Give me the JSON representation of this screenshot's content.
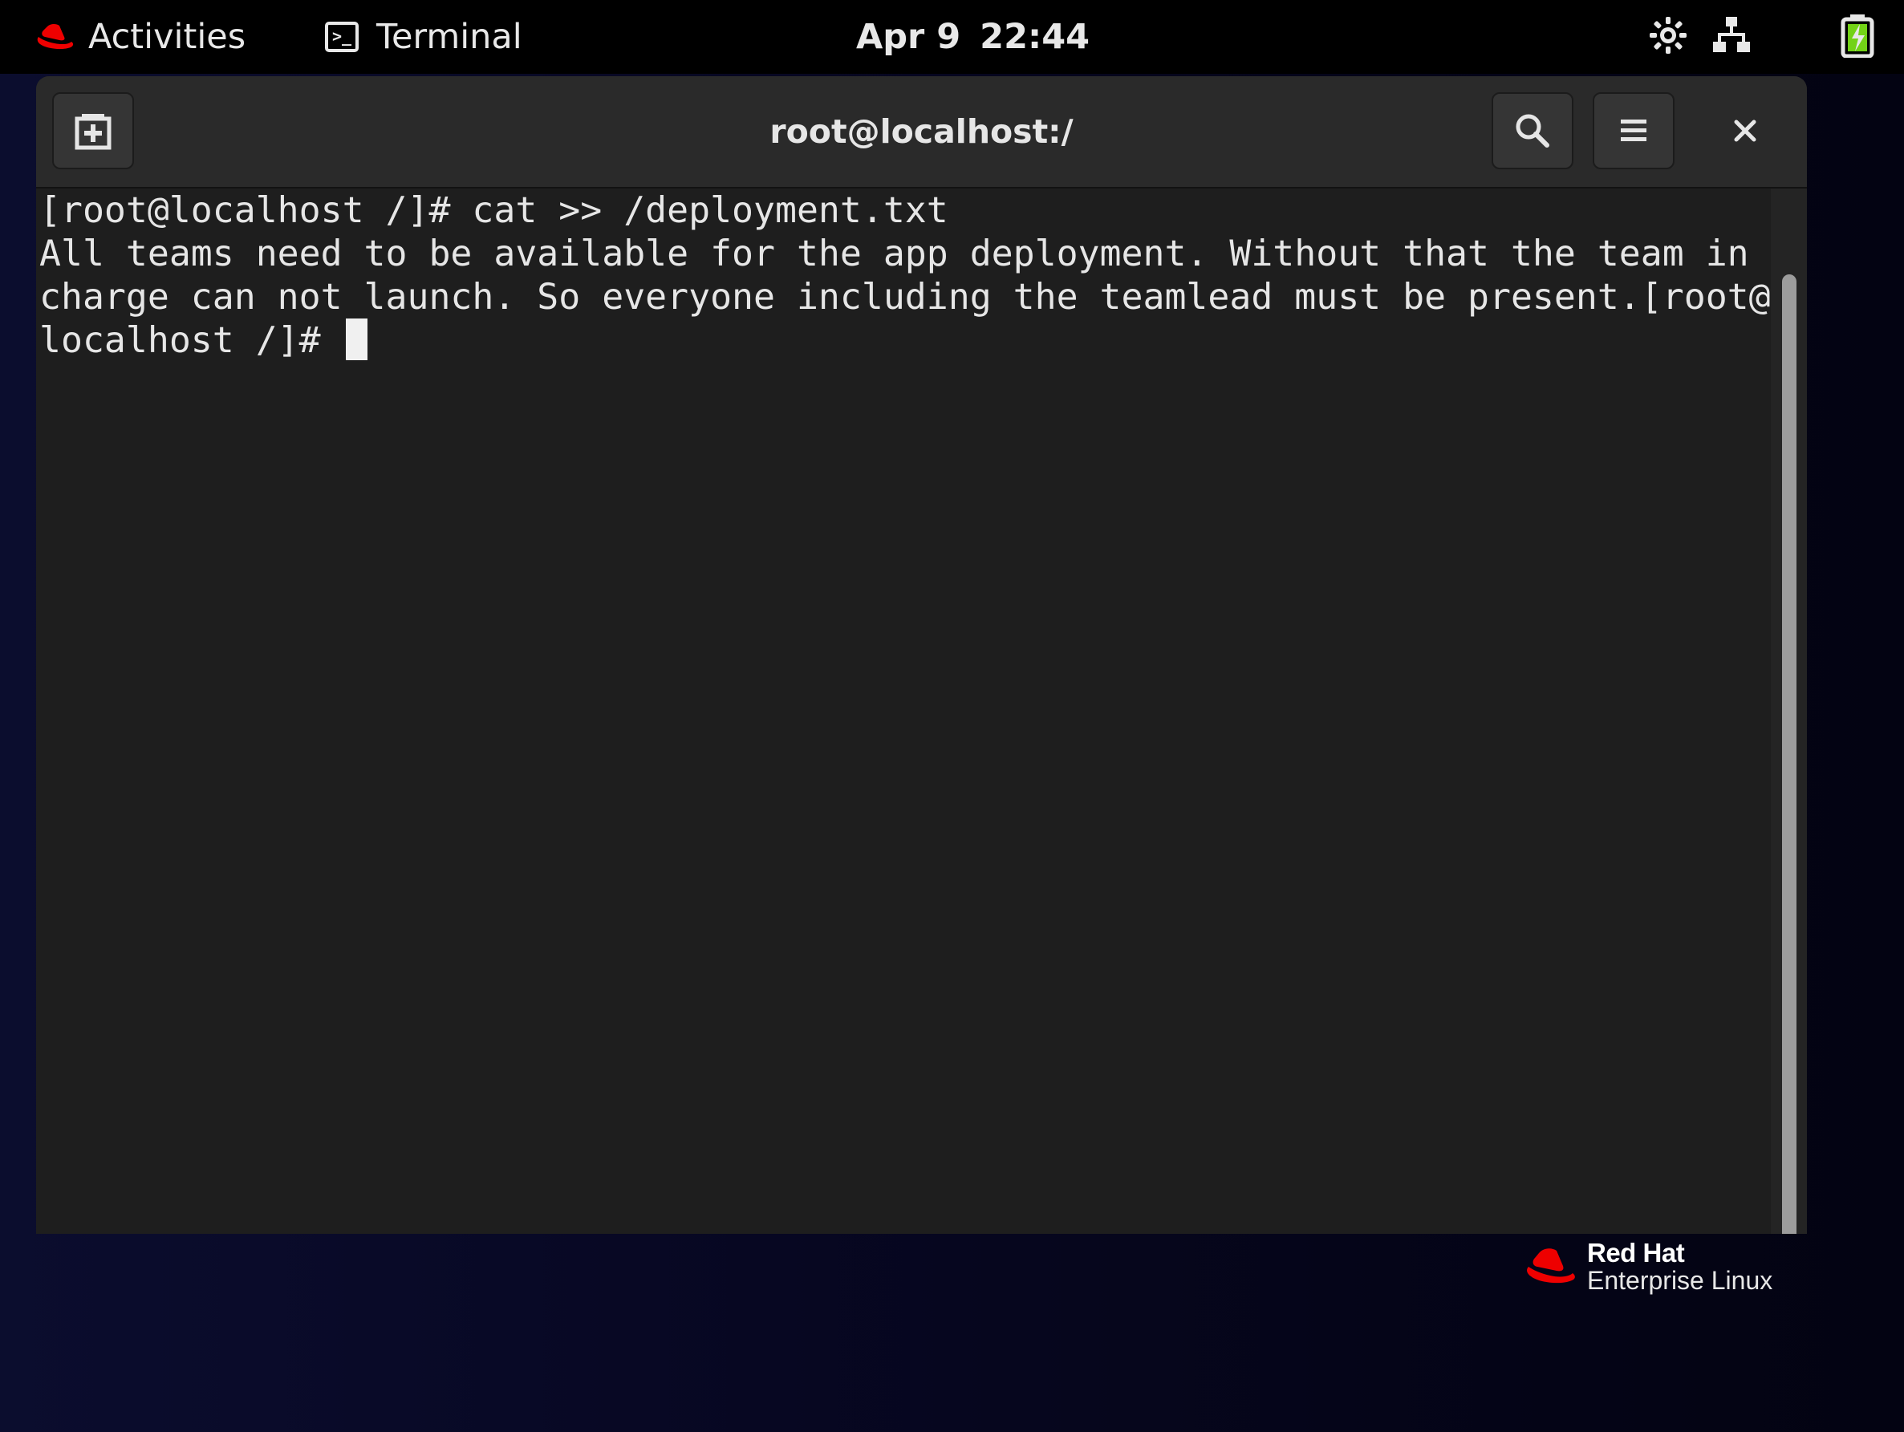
{
  "topbar": {
    "activities_label": "Activities",
    "app_label": "Terminal",
    "app_icon_glyph": ">_",
    "clock_date": "Apr 9",
    "clock_time": "22:44",
    "icons": [
      "redhat-hat-icon",
      "terminal-icon",
      "brightness-icon",
      "network-icon",
      "battery-charging-icon"
    ]
  },
  "window": {
    "title": "root@localhost:/",
    "buttons": [
      "new-tab-icon",
      "search-icon",
      "hamburger-menu-icon",
      "close-icon"
    ]
  },
  "terminal": {
    "lines": [
      "[root@localhost /]# cat >> /deployment.txt",
      "All teams need to be available for the app deployment. Without that the team in",
      "charge can not launch. So everyone including the teamlead must be present.[root@",
      "localhost /]# "
    ]
  },
  "branding": {
    "brand": "Red Hat",
    "product": "Enterprise Linux"
  },
  "colors": {
    "redhat_red": "#ee0000",
    "terminal_bg": "#1e1e1e",
    "headerbar_bg": "#2a2a2a",
    "battery_green": "#73d216"
  }
}
